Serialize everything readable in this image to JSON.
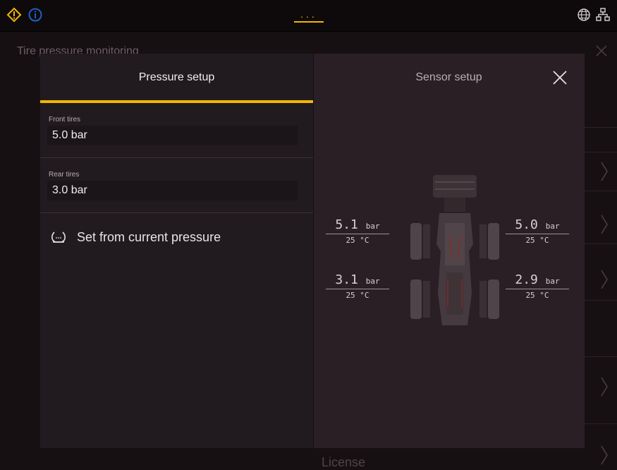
{
  "topbar": {
    "warning_icon": "warning-diamond-icon",
    "info_icon": "info-circle-icon",
    "menu_dots": "...",
    "globe_icon": "globe-icon",
    "network_icon": "network-icon",
    "accent_color": "#f2b600"
  },
  "background": {
    "title": "Tire pressure monitoring",
    "footer_item": "License"
  },
  "modal": {
    "tabs": [
      {
        "label": "Pressure setup",
        "selected": true
      },
      {
        "label": "Sensor setup",
        "selected": false
      }
    ],
    "fields": {
      "front": {
        "label": "Front tires",
        "value": "5.0 bar"
      },
      "rear": {
        "label": "Rear tires",
        "value": "3.0 bar"
      }
    },
    "set_from_current": "Set from current pressure"
  },
  "tires": {
    "front_left": {
      "pressure": "5.1",
      "unit": "bar",
      "temp": "25 °C"
    },
    "front_right": {
      "pressure": "5.0",
      "unit": "bar",
      "temp": "25 °C"
    },
    "rear_left": {
      "pressure": "3.1",
      "unit": "bar",
      "temp": "25 °C"
    },
    "rear_right": {
      "pressure": "2.9",
      "unit": "bar",
      "temp": "25 °C"
    }
  }
}
